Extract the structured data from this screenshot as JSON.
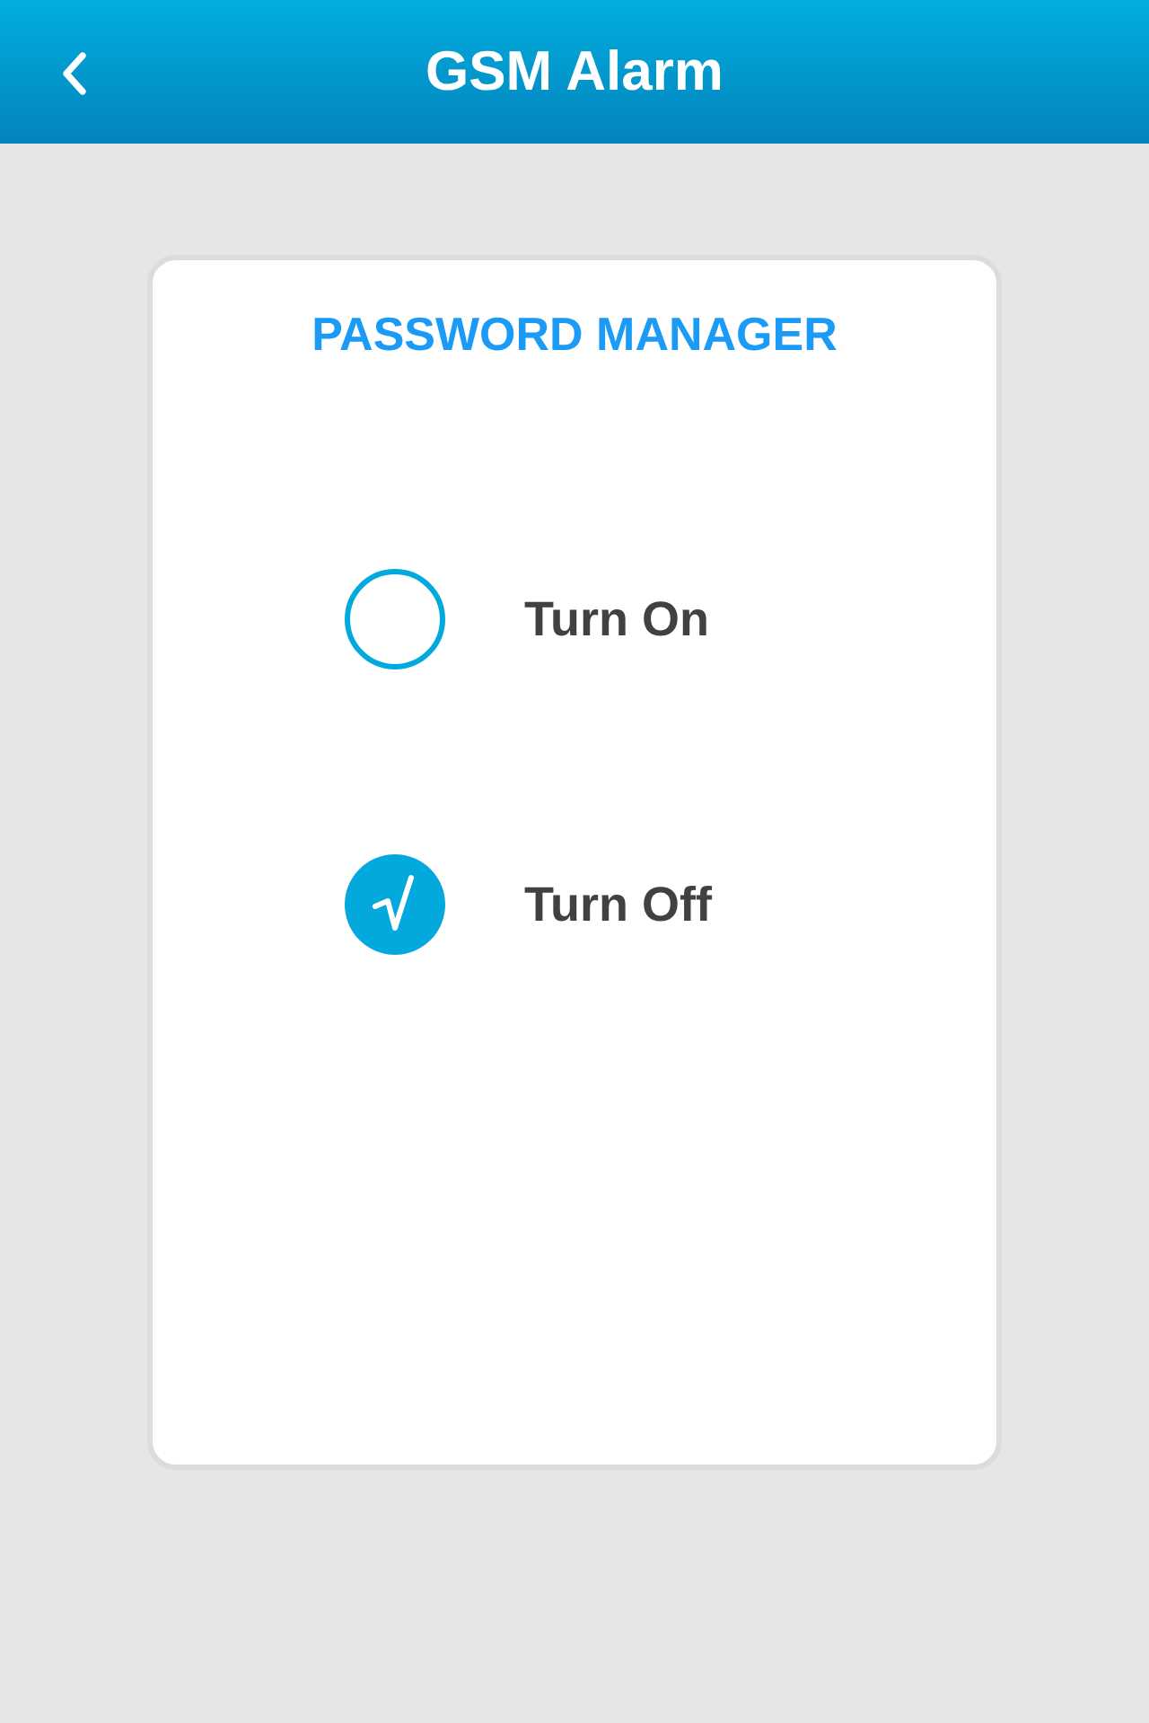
{
  "header": {
    "title": "GSM Alarm"
  },
  "card": {
    "title": "PASSWORD MANAGER"
  },
  "options": [
    {
      "label": "Turn On",
      "selected": false
    },
    {
      "label": "Turn Off",
      "selected": true
    }
  ]
}
